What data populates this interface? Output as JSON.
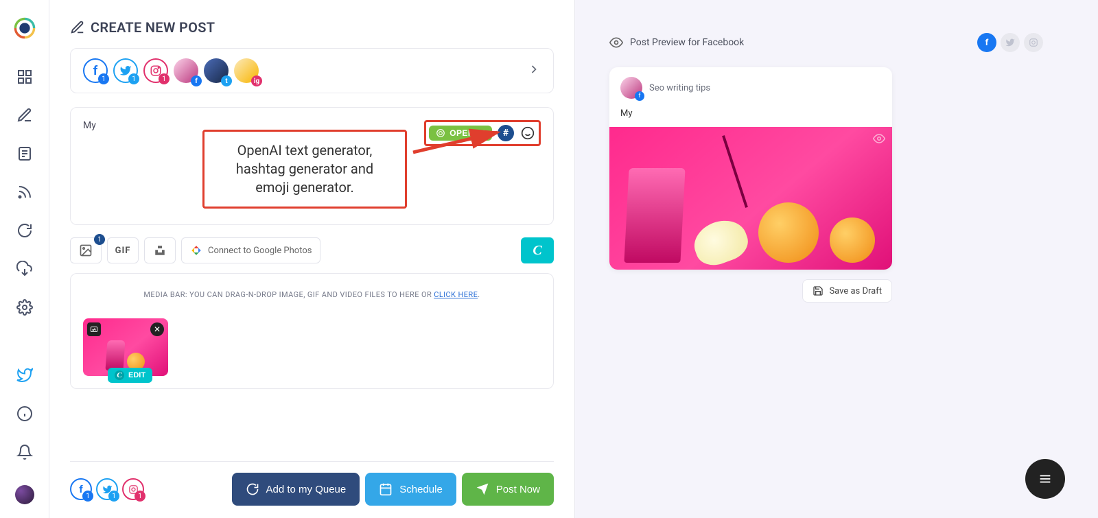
{
  "header": {
    "title": "CREATE NEW POST"
  },
  "accounts": {
    "list": [
      {
        "type": "fb",
        "badge": "1"
      },
      {
        "type": "tw",
        "badge": "1"
      },
      {
        "type": "ig",
        "badge": "1"
      }
    ]
  },
  "compose": {
    "text": "My",
    "tools": {
      "open_ai_label": "OPEN AI",
      "hashtag_char": "#"
    },
    "callout": "OpenAI text generator, hashtag generator and emoji generator."
  },
  "mediaTools": {
    "image_count": "1",
    "gif_label": "GIF",
    "google_photos_label": "Connect to Google Photos",
    "canva_char": "C"
  },
  "mediaBar": {
    "text_pre": "MEDIA BAR: YOU CAN DRAG-N-DROP IMAGE, GIF AND VIDEO FILES TO HERE OR ",
    "click_here": "CLICK HERE",
    "edit_label": "EDIT"
  },
  "bottomBar": {
    "accounts": [
      {
        "type": "fb",
        "badge": "1"
      },
      {
        "type": "tw",
        "badge": "1"
      },
      {
        "type": "ig",
        "badge": "1"
      }
    ],
    "queue_label": "Add to my Queue",
    "schedule_label": "Schedule",
    "post_now_label": "Post Now"
  },
  "preview": {
    "title": "Post Preview for Facebook",
    "account_name": "Seo writing tips",
    "body_text": "My",
    "save_draft_label": "Save as Draft"
  }
}
